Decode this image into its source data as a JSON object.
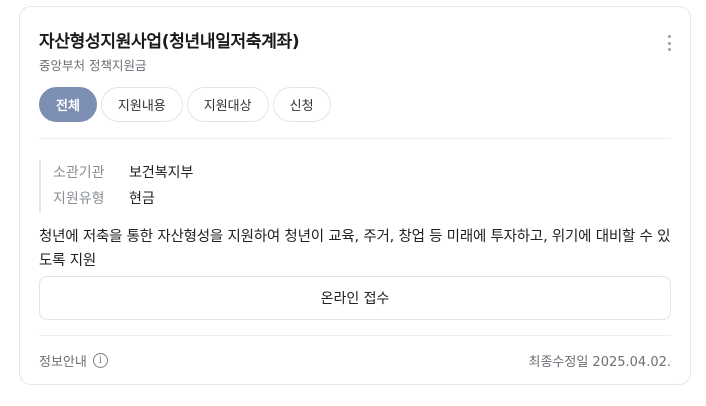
{
  "card": {
    "title": "자산형성지원사업(청년내일저축계좌)",
    "subtitle": "중앙부처 정책지원금",
    "more_icon": "more-vertical-icon"
  },
  "tabs": [
    {
      "label": "전체",
      "active": true
    },
    {
      "label": "지원내용",
      "active": false
    },
    {
      "label": "지원대상",
      "active": false
    },
    {
      "label": "신청",
      "active": false
    }
  ],
  "info": {
    "rows": [
      {
        "label": "소관기관",
        "value": "보건복지부"
      },
      {
        "label": "지원유형",
        "value": "현금"
      }
    ]
  },
  "description": "청년에 저축을 통한 자산형성을 지원하여 청년이 교육, 주거, 창업 등 미래에 투자하고, 위기에 대비할 수 있도록 지원",
  "apply_button": "온라인 접수",
  "footer": {
    "info_label": "정보안내",
    "info_icon": "info-icon",
    "updated": "최종수정일 2025.04.02."
  },
  "colors": {
    "active_tab": "#7d8fb3",
    "border": "#e4e6ea"
  }
}
